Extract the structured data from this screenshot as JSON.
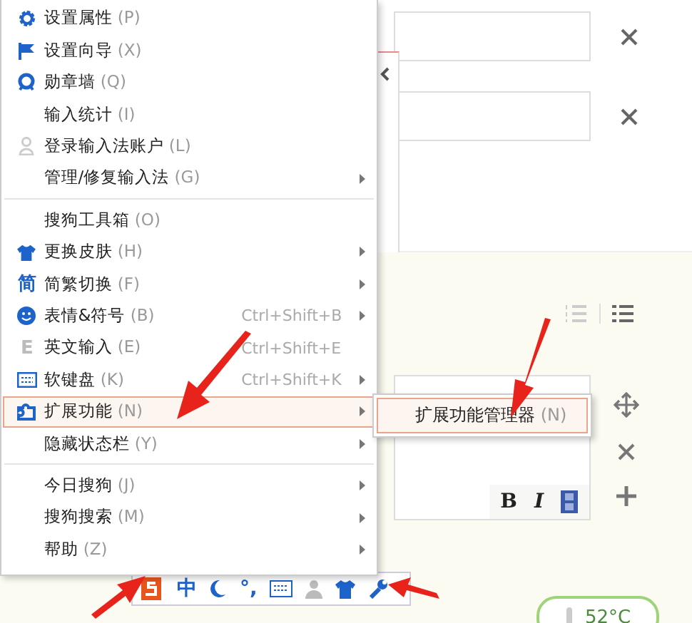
{
  "menu": {
    "sections": [
      [
        {
          "label": "设置属性",
          "key": "(P)",
          "kind": "gear",
          "submenu": false,
          "selected": false
        },
        {
          "label": "设置向导",
          "key": "(X)",
          "kind": "flag",
          "submenu": false,
          "selected": false
        },
        {
          "label": "勋章墙",
          "key": "(Q)",
          "kind": "medal",
          "submenu": false,
          "selected": false
        },
        {
          "label": "输入统计",
          "key": "(I)",
          "kind": "none",
          "submenu": false,
          "selected": false
        },
        {
          "label": "登录输入法账户",
          "key": "(L)",
          "kind": "person",
          "submenu": false,
          "selected": false
        },
        {
          "label": "管理/修复输入法",
          "key": "(G)",
          "kind": "none",
          "submenu": true,
          "selected": false
        }
      ],
      [
        {
          "label": "搜狗工具箱",
          "key": "(O)",
          "kind": "none",
          "submenu": false,
          "selected": false
        },
        {
          "label": "更换皮肤",
          "key": "(H)",
          "kind": "shirt",
          "submenu": true,
          "selected": false
        },
        {
          "label": "简繁切换",
          "key": "(F)",
          "kind": "glyph",
          "glyph": "简",
          "submenu": true,
          "selected": false
        },
        {
          "label": "表情&符号",
          "key": "(B)",
          "kind": "smiley",
          "shortcut": "Ctrl+Shift+B",
          "submenu": true,
          "selected": false
        },
        {
          "label": "英文输入",
          "key": "(E)",
          "kind": "glyph-grey",
          "glyph": "E",
          "shortcut": "Ctrl+Shift+E",
          "submenu": false,
          "selected": false
        },
        {
          "label": "软键盘",
          "key": "(K)",
          "kind": "keyboard",
          "shortcut": "Ctrl+Shift+K",
          "submenu": true,
          "selected": false
        },
        {
          "label": "扩展功能",
          "key": "(N)",
          "kind": "puzzle",
          "submenu": true,
          "selected": true
        },
        {
          "label": "隐藏状态栏",
          "key": "(Y)",
          "kind": "none",
          "submenu": true,
          "selected": false
        }
      ],
      [
        {
          "label": "今日搜狗",
          "key": "(J)",
          "kind": "none",
          "submenu": true,
          "selected": false
        },
        {
          "label": "搜狗搜索",
          "key": "(M)",
          "kind": "none",
          "submenu": true,
          "selected": false
        },
        {
          "label": "帮助",
          "key": "(Z)",
          "kind": "none",
          "submenu": true,
          "selected": false
        }
      ]
    ]
  },
  "submenu": {
    "items": [
      {
        "label": "扩展功能管理器",
        "key": "(N)"
      }
    ]
  },
  "editor": {
    "toolbar": [
      "B",
      "I"
    ]
  },
  "status_bar": {
    "lang": "中",
    "punct": "°,"
  },
  "temperature": "52°C"
}
